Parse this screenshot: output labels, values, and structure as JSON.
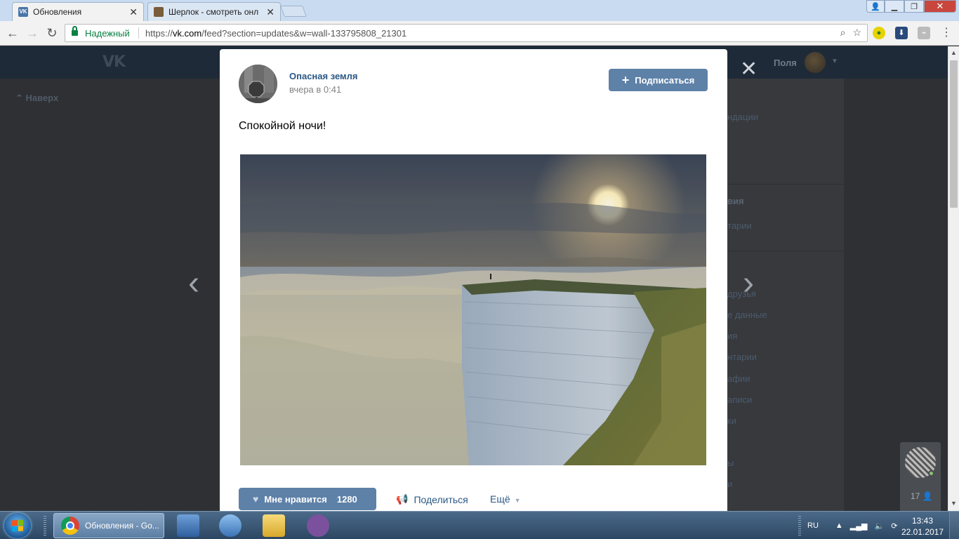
{
  "browser": {
    "tabs": [
      {
        "title": "Обновления",
        "active": true,
        "favicon": "vk-icon",
        "favicon_color": "#4a76a8"
      },
      {
        "title": "Шерлок - смотреть онл",
        "active": false,
        "favicon": "film-icon",
        "favicon_color": "#7a5b3a"
      }
    ],
    "secure_label": "Надежный",
    "url_scheme": "https://",
    "url_host": "vk.com",
    "url_path": "/feed?section=updates&w=wall-133795808_21301"
  },
  "vk": {
    "logo": "VK",
    "user_name": "Поля",
    "back_label": "Наверх",
    "menu_fragments": [
      "ндации",
      "вия",
      "тарии",
      "друзья",
      "е данные",
      "ия",
      "нтарии",
      "афии",
      "аписи",
      "ки",
      "ы",
      "и"
    ]
  },
  "post": {
    "group_name": "Опасная земля",
    "time": "вчера в 0:41",
    "subscribe_label": "Подписаться",
    "text": "Спокойной ночи!",
    "like_label": "Мне нравится",
    "like_count": "1280",
    "share_label": "Поделиться",
    "more_label": "Ещё"
  },
  "widget": {
    "online_count": "17"
  },
  "taskbar": {
    "active_window": "Обновления - Go...",
    "lang": "RU",
    "time": "13:43",
    "date": "22.01.2017"
  },
  "colors": {
    "vk_blue": "#5e81a8",
    "link": "#2a5885",
    "secure": "#0b8043"
  }
}
